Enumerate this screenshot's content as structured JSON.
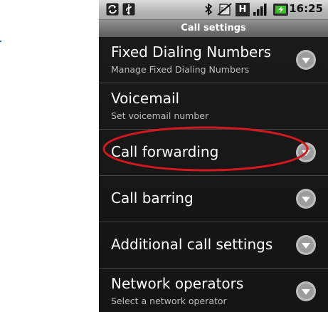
{
  "status_bar": {
    "clock": "16:25",
    "icons": [
      "sync-icon",
      "usb-icon",
      "bluetooth-icon",
      "no-sim-icon",
      "hsdpa-icon",
      "signal-icon",
      "battery-charging-icon"
    ],
    "network_label": "H"
  },
  "header": {
    "title": "Call settings"
  },
  "settings": [
    {
      "title": "Fixed Dialing Numbers",
      "subtitle": "Manage Fixed Dialing Numbers"
    },
    {
      "title": "Voicemail",
      "subtitle": "Set voicemail number"
    },
    {
      "title": "Call forwarding",
      "subtitle": ""
    },
    {
      "title": "Call barring",
      "subtitle": ""
    },
    {
      "title": "Additional call settings",
      "subtitle": ""
    },
    {
      "title": "Network operators",
      "subtitle": "Select a network operator"
    }
  ],
  "annotation": {
    "highlight_color": "#d0181d",
    "highlighted_item": "Call forwarding"
  }
}
